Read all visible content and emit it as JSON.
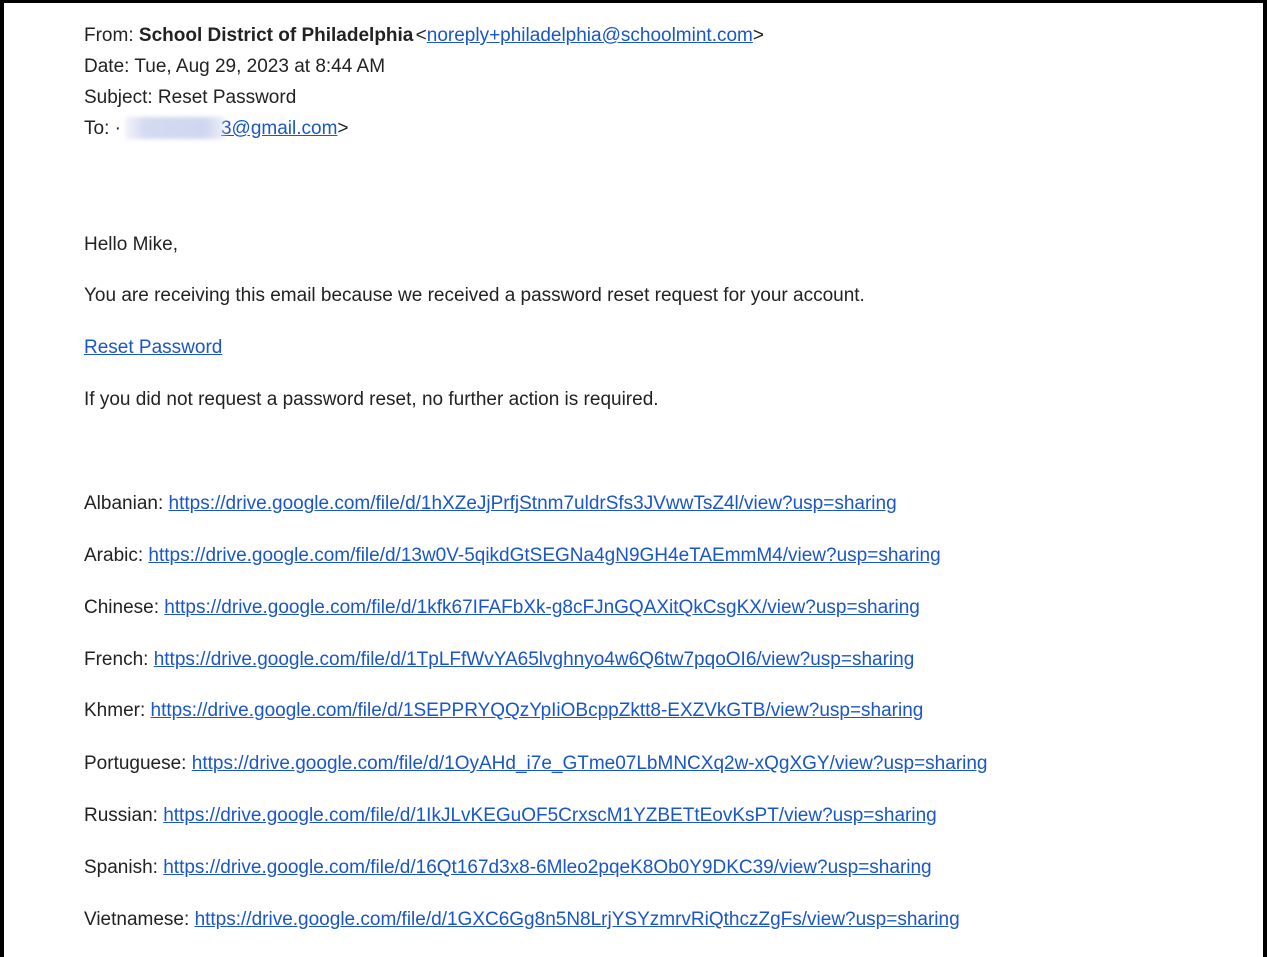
{
  "email": {
    "from_label": "From:",
    "from_name": "School District of Philadelphia",
    "from_open": "<",
    "from_email": "noreply+philadelphia@schoolmint.com",
    "from_close": ">",
    "date_line": "Date: Tue, Aug 29, 2023 at 8:44 AM",
    "subject_line": "Subject: Reset Password",
    "to_label": "To:",
    "to_prefix": "·",
    "to_email_visible": "3@gmail.com",
    "to_close": ">"
  },
  "body": {
    "greeting": "Hello Mike,",
    "intro": "You are receiving this email because we received a password reset request for your account.",
    "reset_link": "Reset Password",
    "no_action": "If you did not request a password reset, no further action is required."
  },
  "languages": [
    {
      "label": "Albanian:",
      "url": "https://drive.google.com/file/d/1hXZeJjPrfjStnm7uldrSfs3JVwwTsZ4l/view?usp=sharing"
    },
    {
      "label": "Arabic:",
      "url": "https://drive.google.com/file/d/13w0V-5qikdGtSEGNa4gN9GH4eTAEmmM4/view?usp=sharing"
    },
    {
      "label": "Chinese:",
      "url": "https://drive.google.com/file/d/1kfk67IFAFbXk-g8cFJnGQAXitQkCsgKX/view?usp=sharing"
    },
    {
      "label": "French:",
      "url": "https://drive.google.com/file/d/1TpLFfWvYA65lvghnyo4w6Q6tw7pqoOI6/view?usp=sharing"
    },
    {
      "label": "Khmer:",
      "url": "https://drive.google.com/file/d/1SEPPRYQQzYpIiOBcppZktt8-EXZVkGTB/view?usp=sharing"
    },
    {
      "label": "Portuguese:",
      "url": "https://drive.google.com/file/d/1OyAHd_i7e_GTme07LbMNCXq2w-xQgXGY/view?usp=sharing"
    },
    {
      "label": "Russian:",
      "url": "https://drive.google.com/file/d/1IkJLvKEGuOF5CrxscM1YZBETtEovKsPT/view?usp=sharing"
    },
    {
      "label": "Spanish:",
      "url": "https://drive.google.com/file/d/16Qt167d3x8-6Mleo2pqeK8Ob0Y9DKC39/view?usp=sharing"
    },
    {
      "label": "Vietnamese:",
      "url": "https://drive.google.com/file/d/1GXC6Gg8n5N8LrjYSYzmrvRiQthczZgFs/view?usp=sharing"
    }
  ],
  "colors": {
    "link": "#1a56c9",
    "text": "#222222",
    "frame": "#000000"
  }
}
